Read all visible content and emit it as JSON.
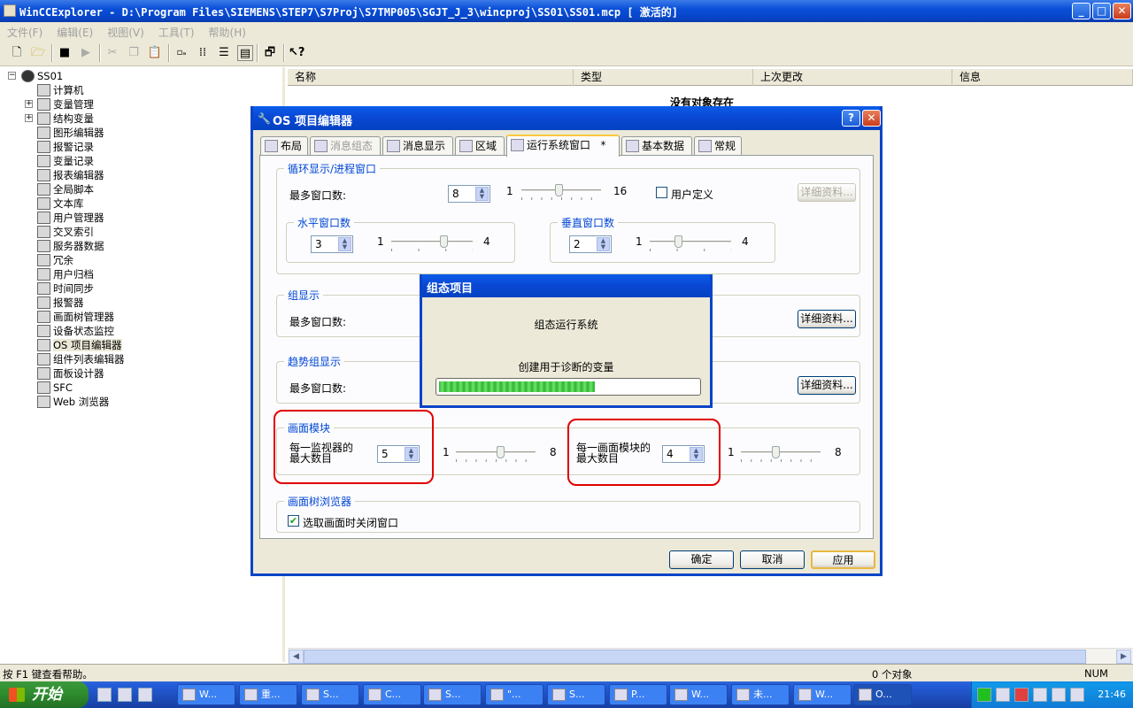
{
  "window": {
    "title": "WinCCExplorer - D:\\Program Files\\SIEMENS\\STEP7\\S7Proj\\S7TMP005\\SGJT_J_3\\wincproj\\SS01\\SS01.mcp [ 激活的]",
    "min": "_",
    "max": "□",
    "close": "✕"
  },
  "menu": [
    "文件(F)",
    "编辑(E)",
    "视图(V)",
    "工具(T)",
    "帮助(H)"
  ],
  "tree": {
    "root": "SS01",
    "items": [
      "计算机",
      "变量管理",
      "结构变量",
      "图形编辑器",
      "报警记录",
      "变量记录",
      "报表编辑器",
      "全局脚本",
      "文本库",
      "用户管理器",
      "交叉索引",
      "服务器数据",
      "冗余",
      "用户归档",
      "时间同步",
      "报警器",
      "画面树管理器",
      "设备状态监控",
      "OS 项目编辑器",
      "组件列表编辑器",
      "面板设计器",
      "SFC",
      "Web 浏览器"
    ],
    "selected": "OS 项目编辑器"
  },
  "list": {
    "columns": [
      "名称",
      "类型",
      "上次更改",
      "信息"
    ],
    "empty": "没有对象存在"
  },
  "dialog": {
    "title": "OS 项目编辑器",
    "help": "?",
    "close": "✕",
    "tabs": [
      "布局",
      "消息组态",
      "消息显示",
      "区域",
      "运行系统窗口   *",
      "基本数据",
      "常规"
    ],
    "activeTab": "运行系统窗口   *",
    "cycle": {
      "title": "循环显示/进程窗口",
      "maxLabel": "最多窗口数:",
      "value": "8",
      "min": "1",
      "max": "16",
      "userDefined": "用户定义",
      "details": "详细资料..."
    },
    "hwin": {
      "title": "水平窗口数",
      "value": "3",
      "min": "1",
      "max": "4"
    },
    "vwin": {
      "title": "垂直窗口数",
      "value": "2",
      "min": "1",
      "max": "4"
    },
    "group": {
      "title": "组显示",
      "maxLabel": "最多窗口数:",
      "details": "详细资料..."
    },
    "trend": {
      "title": "趋势组显示",
      "maxLabel": "最多窗口数:",
      "details": "详细资料..."
    },
    "module": {
      "title": "画面模块",
      "perMonitor": "每一监视器的\n最大数目",
      "perMonitorValue": "5",
      "perMonitorMin": "1",
      "perMonitorMax": "8",
      "perModule": "每一画面模块的\n最大数目",
      "perModuleValue": "4",
      "perModuleMin": "1",
      "perModuleMax": "8"
    },
    "browser": {
      "title": "画面树浏览器",
      "closeOnSelect": "选取画面时关闭窗口"
    },
    "buttons": {
      "ok": "确定",
      "cancel": "取消",
      "apply": "应用"
    }
  },
  "progress": {
    "title": "组态项目",
    "line1": "组态运行系统",
    "line2": "创建用于诊断的变量",
    "percent": 60
  },
  "status": {
    "help": "按 F1 键查看帮助。",
    "count": "0 个对象",
    "num": "NUM"
  },
  "taskbar": {
    "start": "开始",
    "tasks": [
      "W...",
      "重...",
      "S...",
      "C...",
      "S...",
      "\"...",
      "S...",
      "P...",
      "W...",
      "未...",
      "W...",
      "O..."
    ],
    "time": "21:46"
  },
  "colors": {
    "xpBlue": "#0a4fd8",
    "face": "#ece9d8",
    "redHighlight": "#e00000",
    "progressGreen": "#2fb52f"
  }
}
